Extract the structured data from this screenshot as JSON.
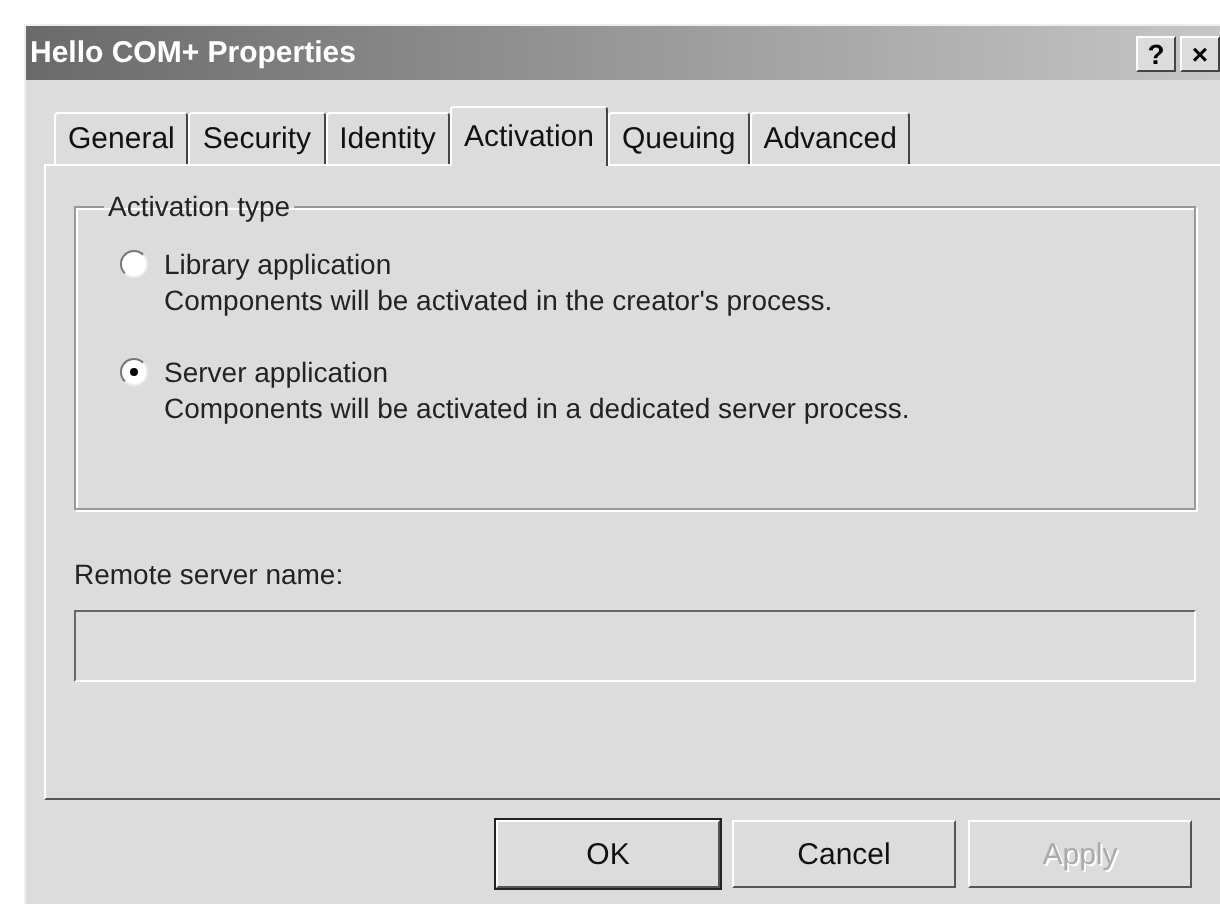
{
  "window": {
    "title": "Hello COM+ Properties",
    "title_buttons": [
      "?",
      "×"
    ]
  },
  "tabs": [
    {
      "label": "General",
      "selected": false
    },
    {
      "label": "Security",
      "selected": false
    },
    {
      "label": "Identity",
      "selected": false
    },
    {
      "label": "Activation",
      "selected": true
    },
    {
      "label": "Queuing",
      "selected": false
    },
    {
      "label": "Advanced",
      "selected": false
    }
  ],
  "activation_type": {
    "title": "Activation type",
    "options": [
      {
        "label": "Library application",
        "description": "Components will be activated in the creator's process.",
        "selected": false
      },
      {
        "label": "Server application",
        "description": "Components will be activated in a dedicated server process.",
        "selected": true
      }
    ]
  },
  "remote_server": {
    "label": "Remote server name:",
    "disabled": true
  },
  "buttons": [
    {
      "label": "OK",
      "default": true,
      "disabled": false
    },
    {
      "label": "Cancel",
      "default": false,
      "disabled": false
    },
    {
      "label": "Apply",
      "default": false,
      "disabled": true
    }
  ]
}
